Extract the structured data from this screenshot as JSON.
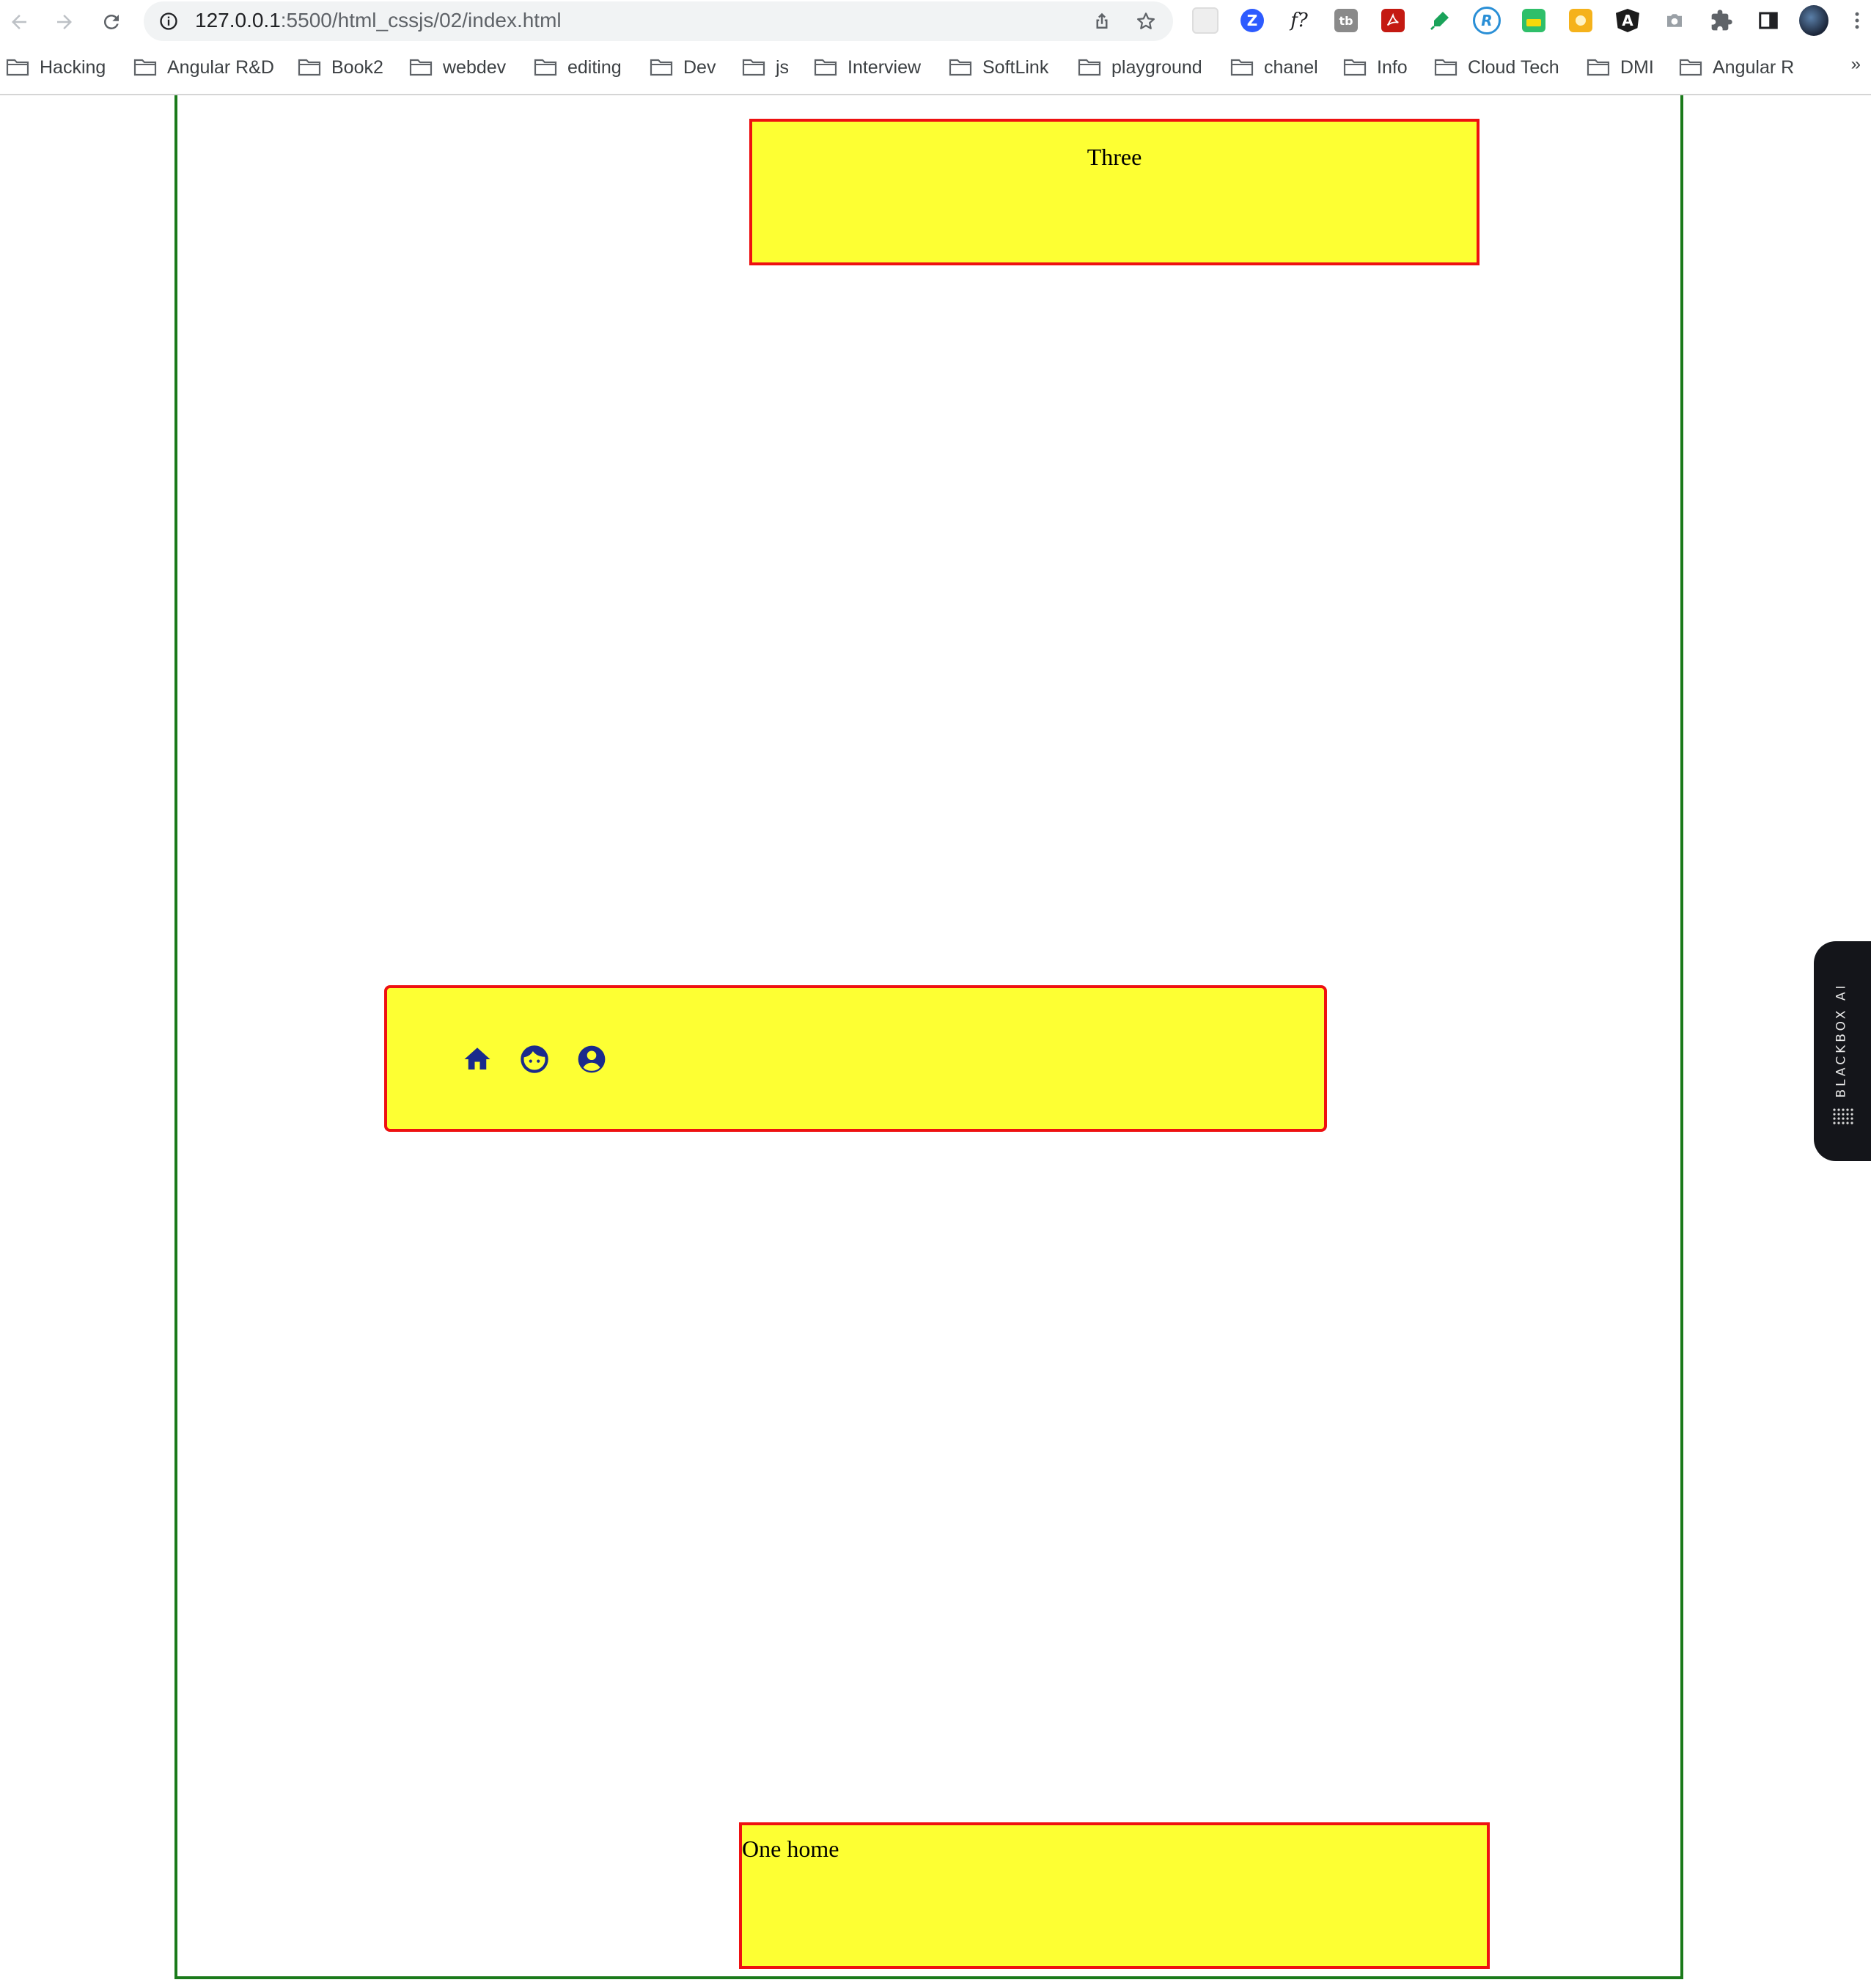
{
  "browser": {
    "url_host": "127.0.0.1",
    "url_path": ":5500/html_cssjs/02/index.html",
    "nav": [
      "back-icon",
      "forward-icon",
      "reload-icon"
    ],
    "extensions": [
      {
        "name": "extension-grid-icon",
        "label": "",
        "color": "#e8e8e8"
      },
      {
        "name": "zoom-extension-icon",
        "label": "Z",
        "color": "#2d5bff"
      },
      {
        "name": "font-finder-extension-icon",
        "label": "f?",
        "color": "#ffffff"
      },
      {
        "name": "tb-extension-icon",
        "label": "tb",
        "color": "#8a8a8a"
      },
      {
        "name": "pdf-extension-icon",
        "label": "",
        "color": "#c41a12"
      },
      {
        "name": "highlighter-extension-icon",
        "label": "",
        "color": "#1aa35a"
      },
      {
        "name": "r-extension-icon",
        "label": "R",
        "color": "#2a8fd6"
      },
      {
        "name": "wallet-extension-icon",
        "label": "",
        "color": "#2fbf6a"
      },
      {
        "name": "idea-extension-icon",
        "label": "",
        "color": "#f5b21b"
      },
      {
        "name": "angular-extension-icon",
        "label": "A",
        "color": "#1b1b1b"
      },
      {
        "name": "camera-extension-icon",
        "label": "",
        "color": "#8a8a8a"
      },
      {
        "name": "puzzle-extensions-icon",
        "label": "",
        "color": "#5f6368"
      },
      {
        "name": "side-panel-icon",
        "label": "",
        "color": "#202124"
      },
      {
        "name": "profile-avatar",
        "label": "",
        "color": "#2b3a55"
      },
      {
        "name": "kebab-menu-icon",
        "label": "",
        "color": "#5f6368"
      }
    ],
    "bookmarks": [
      "Hacking",
      "Angular R&D",
      "Book2",
      "webdev",
      "editing",
      "Dev",
      "js",
      "Interview",
      "SoftLink",
      "playground",
      "chanel",
      "Info",
      "Cloud Tech",
      "DMI",
      "Angular R"
    ],
    "bookmarks_more": "»"
  },
  "page": {
    "box_three": "Three",
    "icons": [
      "home-icon",
      "face-icon",
      "account-circle-icon"
    ],
    "box_home": "One home",
    "colors": {
      "box_fill": "#fdff33",
      "box_border": "#ee1111",
      "container_border": "#1a7a1a",
      "icon": "#1a2a8c"
    }
  },
  "side_tab": {
    "label": "BLACKBOX AI"
  }
}
